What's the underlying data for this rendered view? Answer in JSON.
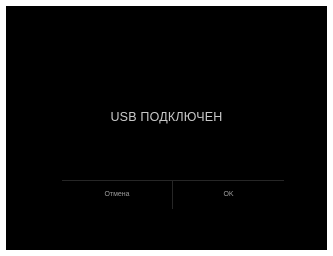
{
  "dialog": {
    "message": "USB ПОДКЛЮЧЕН",
    "cancel_label": "Отмена",
    "ok_label": "OK"
  },
  "colors": {
    "background": "#000000",
    "message_text": "#c8c8c8",
    "button_text": "#9a9a9a",
    "divider": "#262626"
  }
}
